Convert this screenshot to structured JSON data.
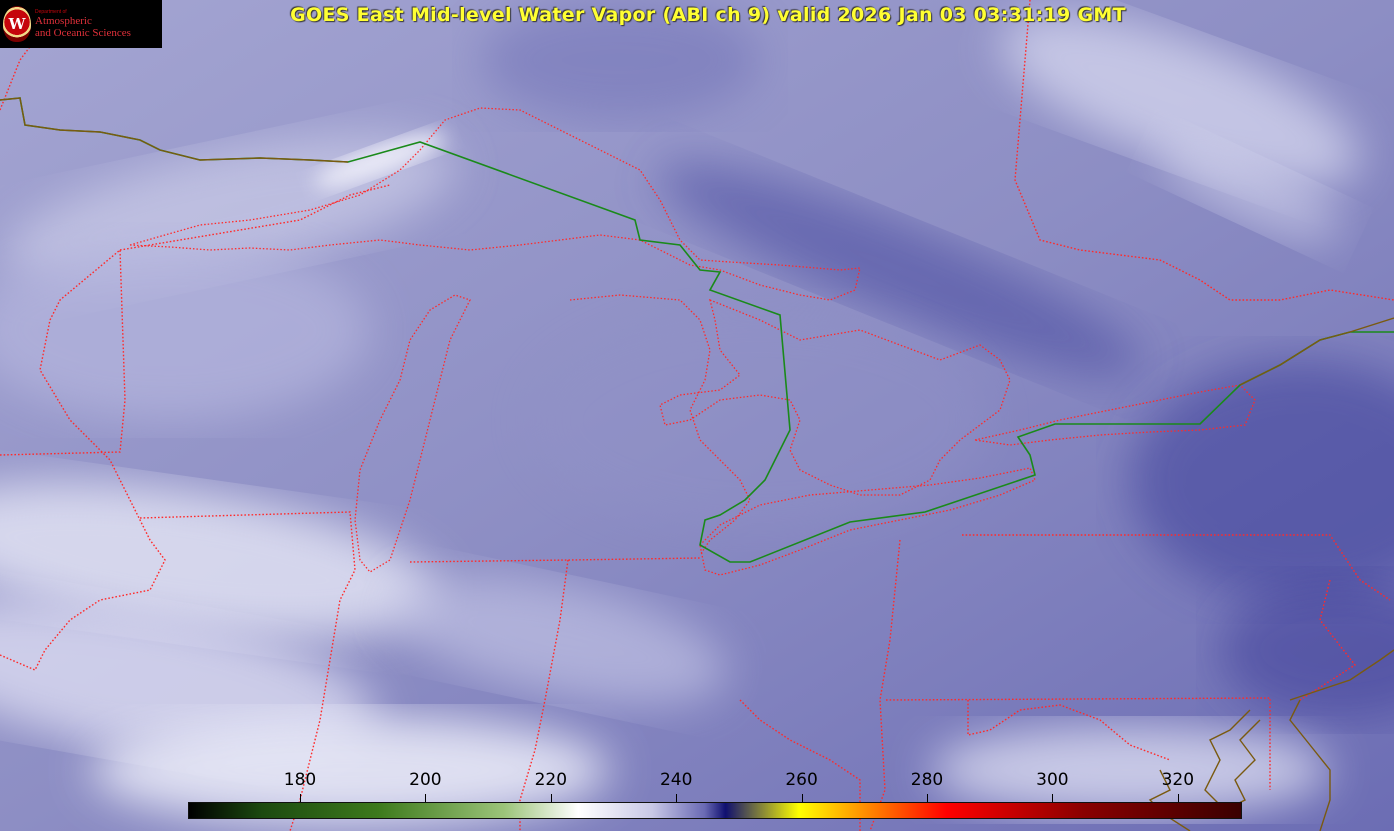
{
  "title": "GOES East Mid-level Water Vapor (ABI ch 9)  valid 2026 Jan 03 03:31:19 GMT",
  "logo": {
    "department": "Department of",
    "line1": "Atmospheric",
    "line2": "and Oceanic Sciences",
    "seal_letter": "W"
  },
  "colorbar": {
    "ticks": [
      "180",
      "200",
      "220",
      "240",
      "260",
      "280",
      "300",
      "320"
    ],
    "stops": [
      "#000000",
      "#1c4a10",
      "#3d7a1c",
      "#9cc47a",
      "#ffffff",
      "#c8c8e6",
      "#6a6ab4",
      "#101070",
      "#ffff00",
      "#ff8000",
      "#ff0000",
      "#8a0000",
      "#3a0000"
    ]
  },
  "colors": {
    "borders": "#ff2a2a",
    "international_border": "#1a8a1a",
    "coast": "#6b5a10"
  }
}
